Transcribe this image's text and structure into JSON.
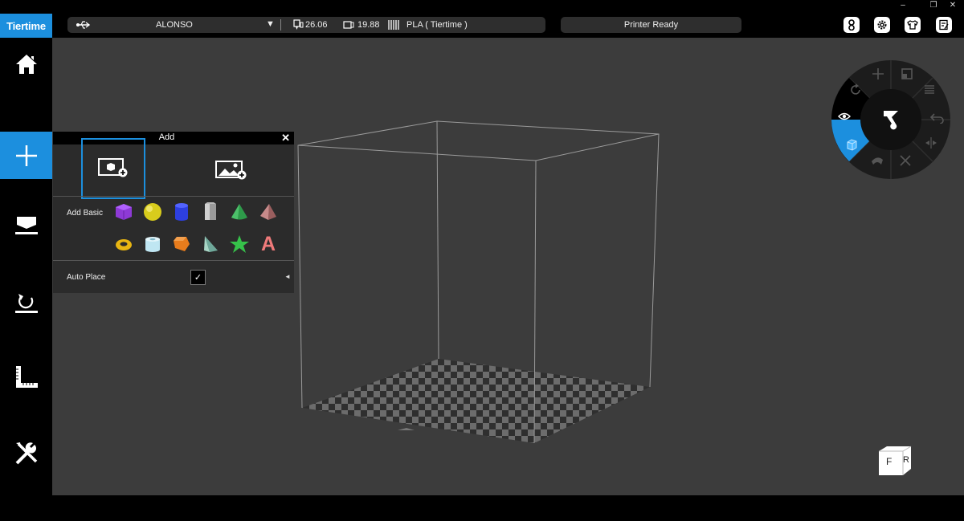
{
  "window_controls": {
    "minimize": "–",
    "maximize": "❐",
    "close": "✕"
  },
  "brand": {
    "logo_text": "Tiertime"
  },
  "printer": {
    "name": "ALONSO",
    "nozzle_temp": "26.06",
    "bed_temp": "19.88",
    "material": "PLA ( Tiertime )",
    "status": "Printer Ready"
  },
  "sidebar": {
    "items": [
      "home-icon",
      "add-icon",
      "print-icon",
      "calibrate-icon",
      "measure-icon",
      "tools-icon"
    ]
  },
  "add_panel": {
    "title": "Add",
    "close": "✕",
    "add_basic_label": "Add Basic",
    "auto_place_label": "Auto Place",
    "auto_place_checked": "✓",
    "collapse_arrow": "◄",
    "shapes_row1": [
      "cube",
      "sphere",
      "cylinder",
      "hexagonal-prism",
      "cone",
      "pyramid"
    ],
    "shapes_row2": [
      "torus",
      "tube",
      "pentagon-prism",
      "wedge",
      "star",
      "letter-a"
    ],
    "letter_shape": "A"
  },
  "view_cube": {
    "front": "F",
    "right": "R"
  },
  "colors": {
    "accent": "#1c8fde",
    "viewport": "#3c3c3c",
    "panel": "#2b2b2b"
  }
}
